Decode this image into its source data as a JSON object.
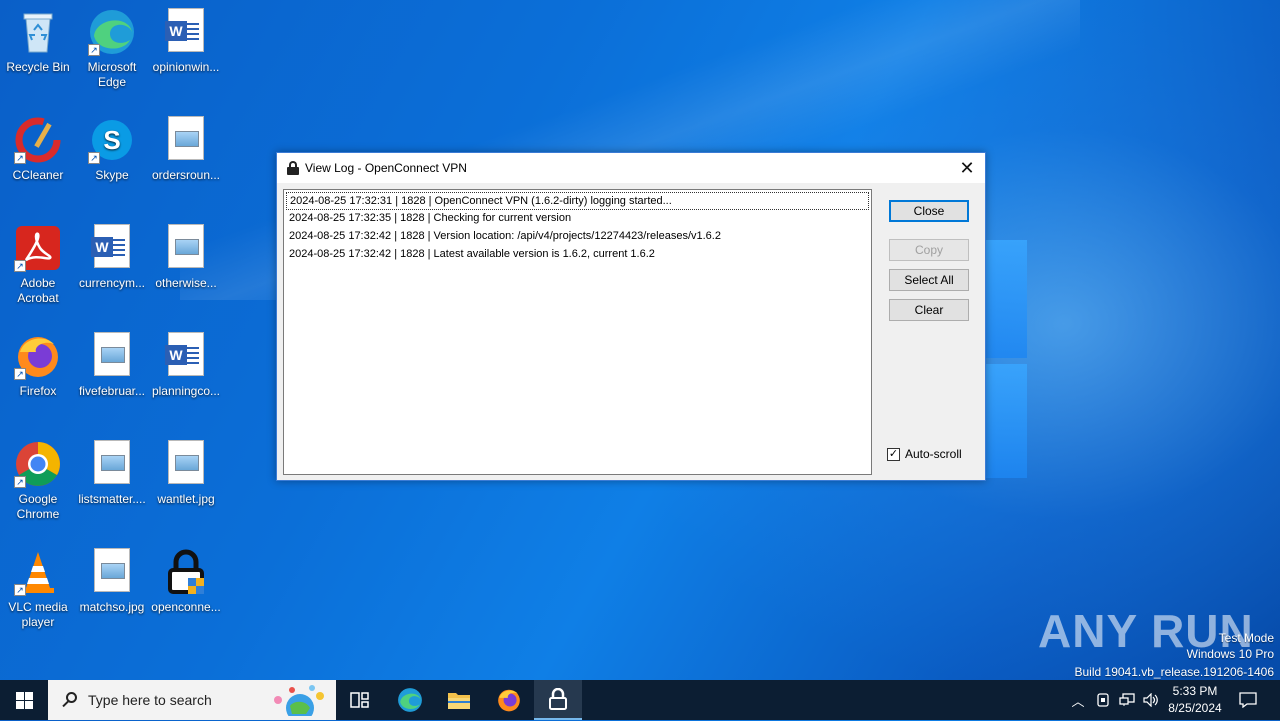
{
  "desktop": {
    "icons": [
      {
        "label": "Recycle Bin"
      },
      {
        "label": "Microsoft Edge"
      },
      {
        "label": "opinionwin..."
      },
      {
        "label": "CCleaner"
      },
      {
        "label": "Skype"
      },
      {
        "label": "ordersroun..."
      },
      {
        "label": "Adobe Acrobat"
      },
      {
        "label": "currencym..."
      },
      {
        "label": "otherwise..."
      },
      {
        "label": "Firefox"
      },
      {
        "label": "fivefebruar..."
      },
      {
        "label": "planningco..."
      },
      {
        "label": "Google Chrome"
      },
      {
        "label": "listsmatter...."
      },
      {
        "label": "wantlet.jpg"
      },
      {
        "label": "VLC media player"
      },
      {
        "label": "matchso.jpg"
      },
      {
        "label": "openconne..."
      }
    ]
  },
  "dialog": {
    "title": "View Log - OpenConnect VPN",
    "log_lines": [
      "2024-08-25 17:32:31 | 1828 | OpenConnect VPN (1.6.2-dirty) logging started...",
      "2024-08-25 17:32:35 | 1828 | Checking for current version",
      "2024-08-25 17:32:42 | 1828 | Version location: /api/v4/projects/12274423/releases/v1.6.2",
      "2024-08-25 17:32:42 | 1828 | Latest available version is 1.6.2, current 1.6.2"
    ],
    "buttons": {
      "close": "Close",
      "copy": "Copy",
      "select_all": "Select All",
      "clear": "Clear"
    },
    "autoscroll_label": "Auto-scroll",
    "autoscroll_checked": true
  },
  "watermark": {
    "brand": "ANY RUN",
    "test_mode": "Test Mode",
    "edition": "Windows 10 Pro",
    "build": "Build 19041.vb_release.191206-1406"
  },
  "taskbar": {
    "search_placeholder": "Type here to search",
    "time": "5:33 PM",
    "date": "8/25/2024"
  },
  "colors": {
    "accent": "#0078d7",
    "taskbar": "#0c1e33"
  }
}
